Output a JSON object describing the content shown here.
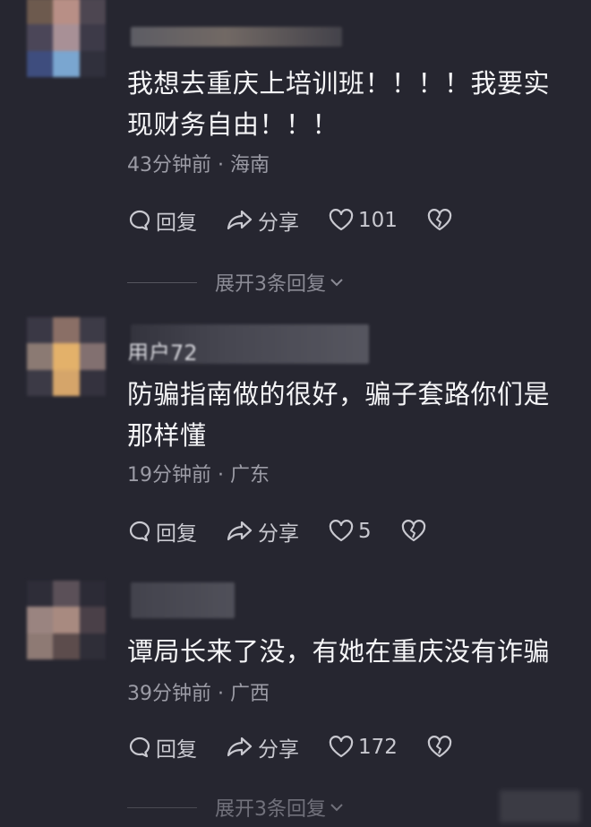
{
  "comments": [
    {
      "text": "我想去重庆上培训班！！！！我要实现财务自由！！！",
      "time": "43分钟前",
      "location": "海南",
      "reply_label": "回复",
      "share_label": "分享",
      "likes": "101",
      "expand_label": "展开3条回复"
    },
    {
      "name_partial": "用户72",
      "text": "防骗指南做的很好，骗子套路你们是那样懂",
      "time": "19分钟前",
      "location": "广东",
      "reply_label": "回复",
      "share_label": "分享",
      "likes": "5"
    },
    {
      "text": "谭局长来了没，有她在重庆没有诈骗",
      "time": "39分钟前",
      "location": "广西",
      "reply_label": "回复",
      "share_label": "分享",
      "likes": "172",
      "expand_label": "展开3条回复"
    }
  ],
  "separator": "·",
  "icons": {
    "reply": "comment-bubble-icon",
    "share": "share-arrow-icon",
    "like": "heart-icon",
    "dislike": "broken-heart-icon",
    "expand": "chevron-down-icon"
  },
  "colors": {
    "background": "#262630",
    "text": "#f5f5f7",
    "meta": "#9c9ca6",
    "action": "#c9c9d0"
  }
}
